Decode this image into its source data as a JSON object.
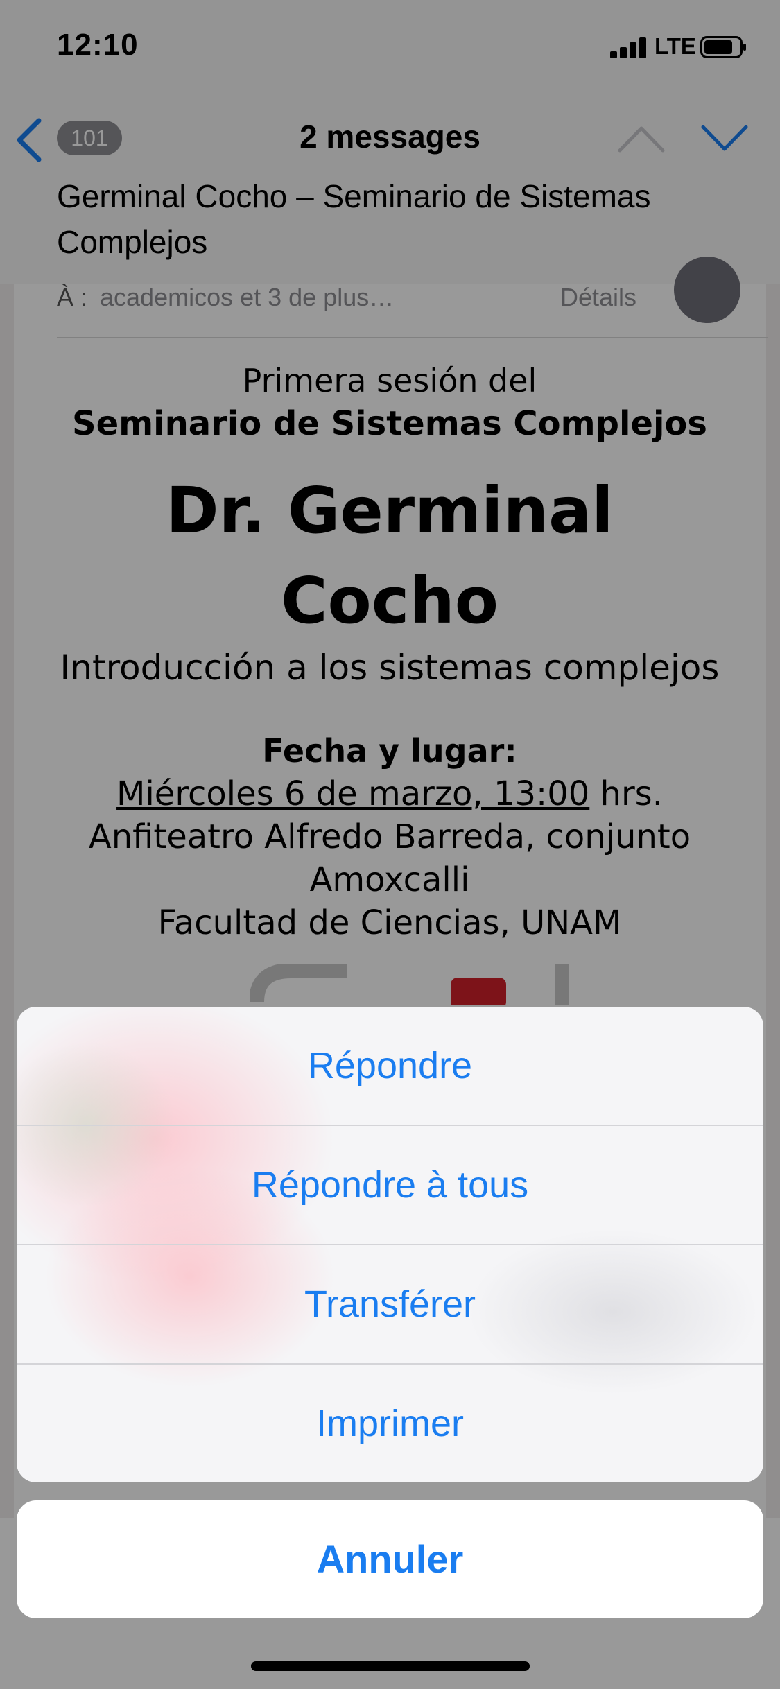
{
  "status_bar": {
    "time": "12:10",
    "network": "LTE"
  },
  "nav": {
    "unread_count": "101",
    "title": "2 messages",
    "subject": "Germinal Cocho – Seminario de Sistemas Complejos"
  },
  "header": {
    "to_label": "À :",
    "to_value": "academicos et 3 de plus…",
    "details": "Détails"
  },
  "email": {
    "line1": "Primera sesión del",
    "line2": "Seminario de Sistemas Complejos",
    "speaker": "Dr. Germinal Cocho",
    "talk": "Introducción a los sistemas complejos",
    "date_heading": "Fecha y lugar:",
    "date": "Miércoles 6 de marzo, 13:00",
    "date_suffix": " hrs.",
    "venue_line1": "Anfiteatro Alfredo Barreda, conjunto",
    "venue_line2": "Amoxcalli",
    "venue_line3": "Facultad de Ciencias, UNAM"
  },
  "action_sheet": {
    "reply": "Répondre",
    "reply_all": "Répondre à tous",
    "forward": "Transférer",
    "print": "Imprimer",
    "cancel": "Annuler"
  },
  "colors": {
    "accent": "#1a7df0",
    "badge": "#8e8e93"
  }
}
